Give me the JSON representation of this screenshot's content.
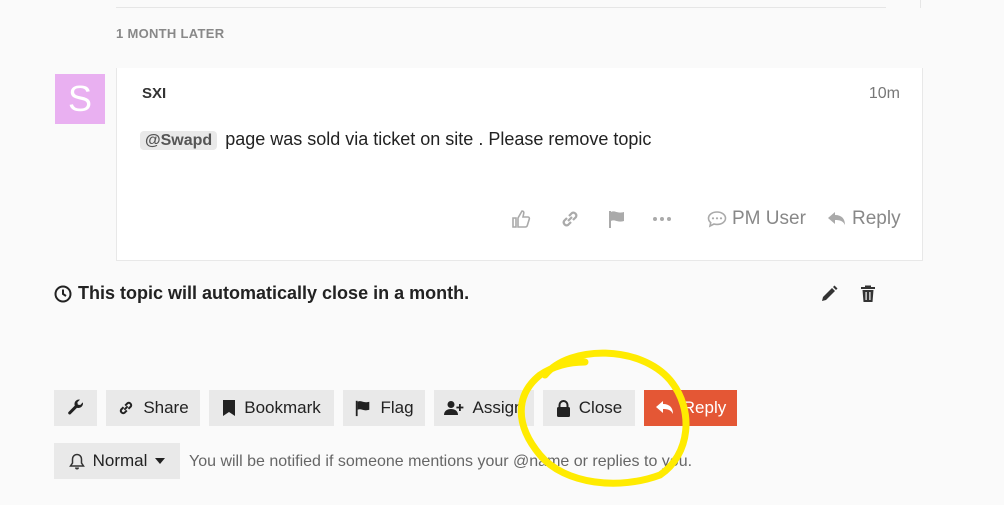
{
  "time_gap": {
    "label": "1 MONTH LATER"
  },
  "post": {
    "avatar_letter": "S",
    "avatar_color": "#e9b0f1",
    "username": "SXI",
    "date": "10m",
    "mention": "@Swapd",
    "body_text": "page was sold via ticket on site . Please remove topic",
    "actions": {
      "like_icon": "thumbs-up-icon",
      "link_icon": "link-icon",
      "flag_icon": "flag-icon",
      "more_icon": "ellipsis-icon",
      "pm_label": "PM User",
      "reply_label": "Reply"
    }
  },
  "topic_timer": {
    "text": "This topic will automatically close in a month.",
    "icon": "clock-icon"
  },
  "footer_buttons": {
    "admin_icon": "wrench-icon",
    "share": "Share",
    "bookmark": "Bookmark",
    "flag": "Flag",
    "assign": "Assign",
    "close": "Close",
    "reply": "Reply"
  },
  "notifications": {
    "level": "Normal",
    "description": "You will be notified if someone mentions your @name or replies to you."
  },
  "colors": {
    "reply_button": "#e45735",
    "highlight": "#ffeb00"
  }
}
